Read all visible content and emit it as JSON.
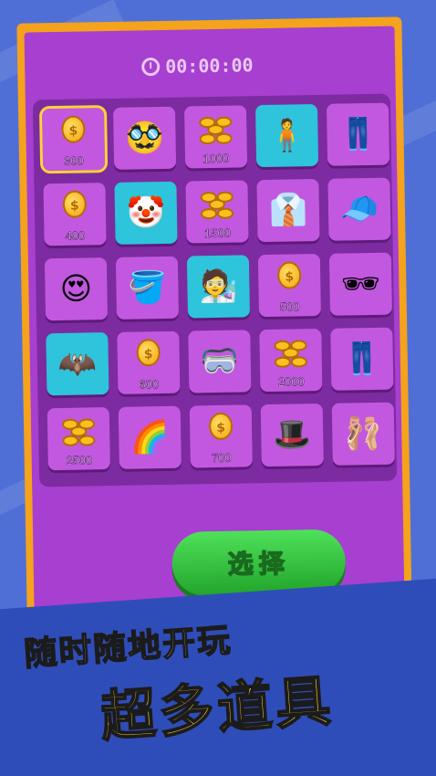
{
  "timer": "00:00:00",
  "select_label": "选择",
  "slogan_line1": "随时随地开玩",
  "slogan_line2": "超多道具",
  "colors": {
    "background": "#4f6fd6",
    "panel_border": "#f5a21c",
    "panel": "#a73fd0",
    "button": "#2fbf3a",
    "highlight": "#ffd23a"
  },
  "items": [
    {
      "row": 0,
      "col": 0,
      "type": "coin",
      "price": "300",
      "selected": true
    },
    {
      "row": 0,
      "col": 1,
      "type": "glasses-mustache-icon"
    },
    {
      "row": 0,
      "col": 2,
      "type": "coin-stack",
      "price": "1000"
    },
    {
      "row": 0,
      "col": 3,
      "type": "pink-suit-character-icon",
      "teal": true
    },
    {
      "row": 0,
      "col": 4,
      "type": "green-pants-icon"
    },
    {
      "row": 1,
      "col": 0,
      "type": "coin",
      "price": "400"
    },
    {
      "row": 1,
      "col": 1,
      "type": "joker-character-icon",
      "teal": true
    },
    {
      "row": 1,
      "col": 2,
      "type": "coin-stack",
      "price": "1500"
    },
    {
      "row": 1,
      "col": 3,
      "type": "shirt-icon"
    },
    {
      "row": 1,
      "col": 4,
      "type": "cap-icon"
    },
    {
      "row": 2,
      "col": 0,
      "type": "heart-glasses-icon"
    },
    {
      "row": 2,
      "col": 1,
      "type": "paint-bucket-icon"
    },
    {
      "row": 2,
      "col": 2,
      "type": "scientist-character-icon",
      "teal": true
    },
    {
      "row": 2,
      "col": 3,
      "type": "coin",
      "price": "500"
    },
    {
      "row": 2,
      "col": 4,
      "type": "pixel-sunglasses-icon"
    },
    {
      "row": 3,
      "col": 0,
      "type": "batman-character-icon",
      "teal": true
    },
    {
      "row": 3,
      "col": 1,
      "type": "coin",
      "price": "600"
    },
    {
      "row": 3,
      "col": 2,
      "type": "goggles-icon"
    },
    {
      "row": 3,
      "col": 3,
      "type": "coin-stack",
      "price": "2000"
    },
    {
      "row": 3,
      "col": 4,
      "type": "black-pants-icon"
    },
    {
      "row": 4,
      "col": 0,
      "type": "coin-stack",
      "price": "2500"
    },
    {
      "row": 4,
      "col": 1,
      "type": "rainbow-bucket-icon"
    },
    {
      "row": 4,
      "col": 2,
      "type": "coin",
      "price": "700"
    },
    {
      "row": 4,
      "col": 3,
      "type": "fedora-hat-icon"
    },
    {
      "row": 4,
      "col": 4,
      "type": "pink-shoes-icon"
    }
  ]
}
